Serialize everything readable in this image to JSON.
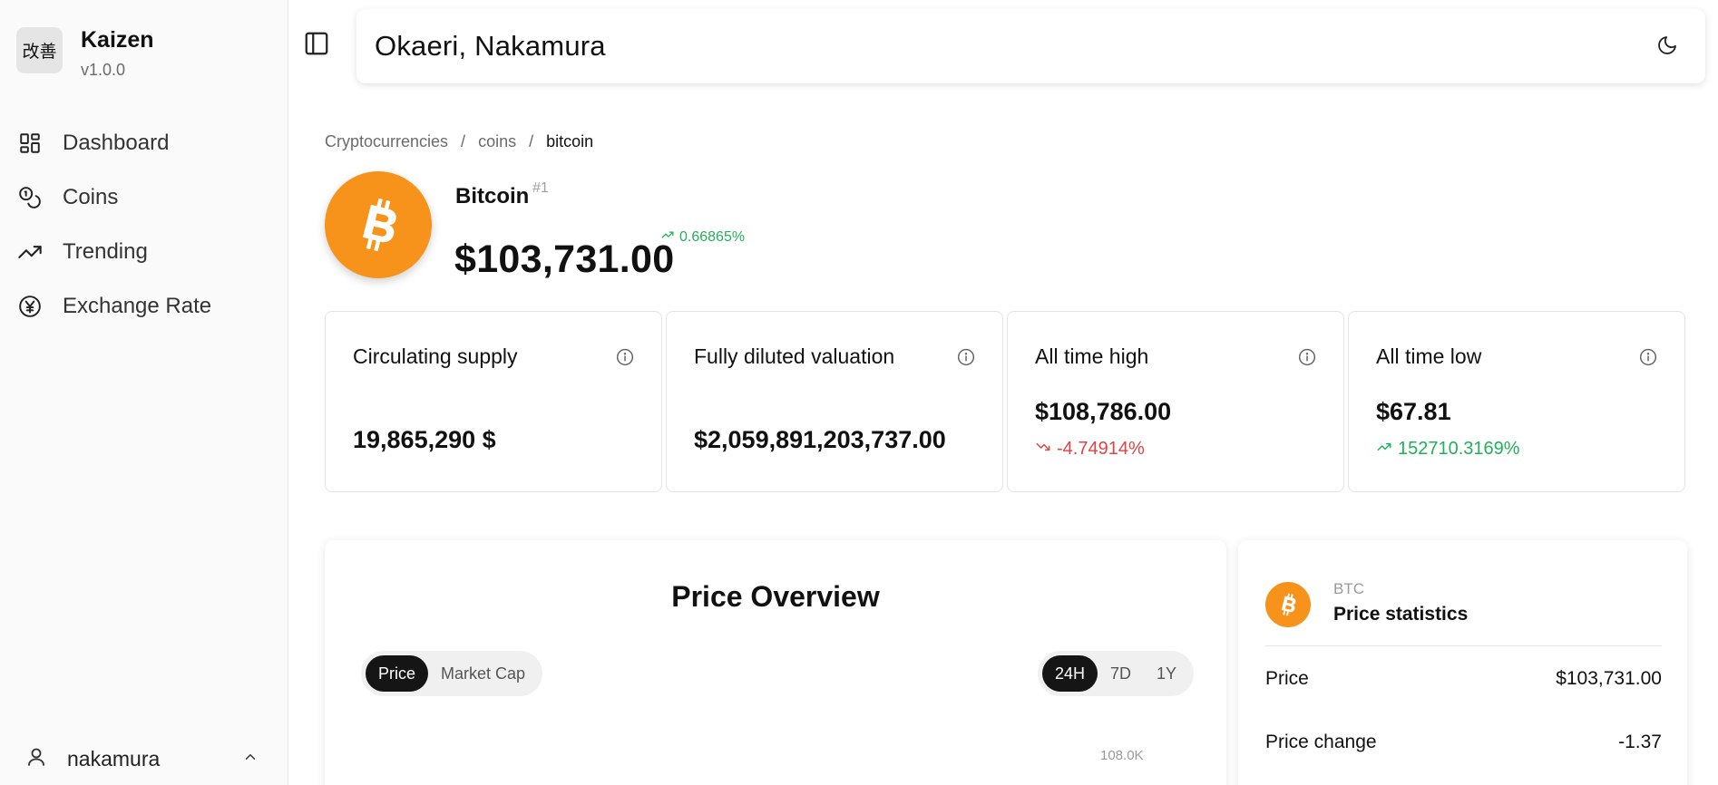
{
  "app": {
    "brand_logo_text": "改善",
    "brand_name": "Kaizen",
    "version": "v1.0.0"
  },
  "sidebar": {
    "items": [
      {
        "label": "Dashboard",
        "icon": "dashboard-grid-icon"
      },
      {
        "label": "Coins",
        "icon": "coins-icon"
      },
      {
        "label": "Trending",
        "icon": "trending-up-icon"
      },
      {
        "label": "Exchange Rate",
        "icon": "yen-circle-icon"
      }
    ],
    "user": {
      "name": "nakamura",
      "icon": "user-icon"
    }
  },
  "header": {
    "greeting": "Okaeri, Nakamura",
    "theme_icon": "moon-icon",
    "sidebar_toggle_icon": "panel-left-icon"
  },
  "breadcrumb": [
    "Cryptocurrencies",
    "coins",
    "bitcoin"
  ],
  "coin": {
    "name": "Bitcoin",
    "rank": "#1",
    "price": "$103,731.00",
    "change": "0.66865%",
    "symbol": "BTC"
  },
  "stats": [
    {
      "title": "Circulating supply",
      "value": "19,865,290 $",
      "delta": "",
      "direction": ""
    },
    {
      "title": "Fully diluted valuation",
      "value": "$2,059,891,203,737.00",
      "delta": "",
      "direction": ""
    },
    {
      "title": "All time high",
      "value": "$108,786.00",
      "delta": "-4.74914%",
      "direction": "down"
    },
    {
      "title": "All time low",
      "value": "$67.81",
      "delta": "152710.3169%",
      "direction": "up"
    }
  ],
  "overview": {
    "title": "Price Overview",
    "metric_tabs": [
      "Price",
      "Market Cap"
    ],
    "active_metric": "Price",
    "range_tabs": [
      "24H",
      "7D",
      "1Y"
    ],
    "active_range": "24H",
    "axis_tick": "108.0K"
  },
  "price_statistics": {
    "symbol": "BTC",
    "title": "Price statistics",
    "rows": [
      {
        "label": "Price",
        "value": "$103,731.00"
      },
      {
        "label": "Price change",
        "value": "-1.37"
      }
    ]
  },
  "colors": {
    "bitcoin_orange": "#f7931a",
    "positive": "#22b05a",
    "negative": "#e04444",
    "active_tab": "#151515"
  }
}
